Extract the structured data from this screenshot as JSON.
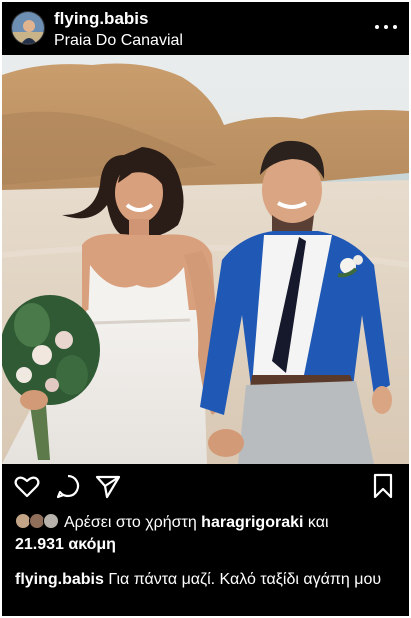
{
  "post": {
    "username": "flying.babis",
    "location": "Praia Do Canavial"
  },
  "likes": {
    "prefix": "Αρέσει στο χρήστη ",
    "user": "haragrigoraki",
    "connector": " και",
    "count": "21.931 ακόμη"
  },
  "caption": {
    "username": "flying.babis",
    "text": " Για πάντα μαζί. Καλό ταξίδι αγάπη μου"
  },
  "icons": {
    "more": "more-options-icon",
    "like": "heart-icon",
    "comment": "comment-icon",
    "share": "send-icon",
    "save": "bookmark-icon"
  }
}
